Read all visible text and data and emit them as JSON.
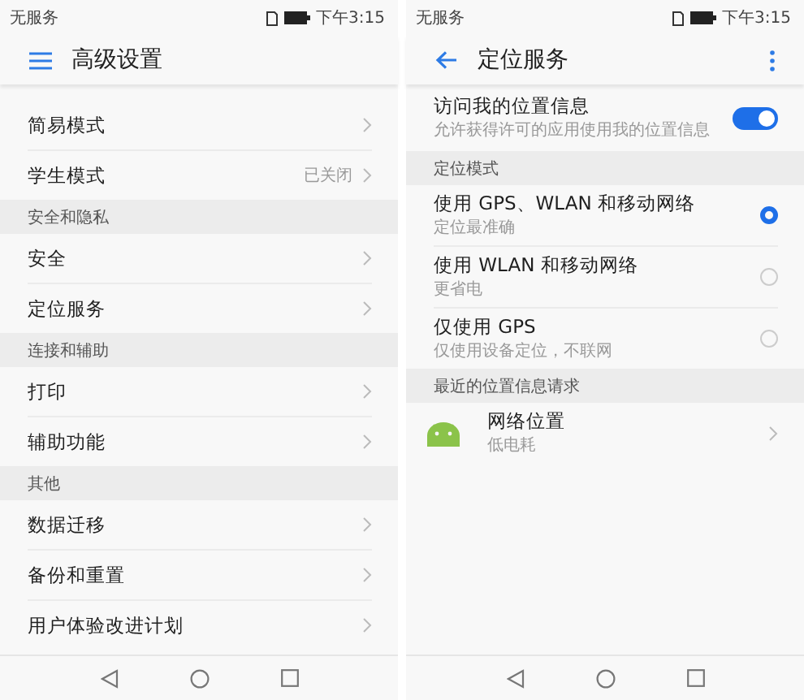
{
  "screens": [
    {
      "status_bar": {
        "carrier": "无服务",
        "time": "下午3:15"
      },
      "header": {
        "leading": {
          "kind": "menu"
        },
        "title": "高级设置",
        "more_menu": false
      },
      "items": [
        {
          "kind": "row",
          "title": "简易模式"
        },
        {
          "kind": "row",
          "title": "学生模式",
          "value": "已关闭"
        },
        {
          "kind": "section",
          "title": "安全和隐私"
        },
        {
          "kind": "row",
          "title": "安全"
        },
        {
          "kind": "row",
          "title": "定位服务"
        },
        {
          "kind": "section",
          "title": "连接和辅助"
        },
        {
          "kind": "row",
          "title": "打印"
        },
        {
          "kind": "row",
          "title": "辅助功能"
        },
        {
          "kind": "section",
          "title": "其他"
        },
        {
          "kind": "row",
          "title": "数据迁移"
        },
        {
          "kind": "row",
          "title": "备份和重置"
        },
        {
          "kind": "row",
          "title": "用户体验改进计划"
        }
      ]
    },
    {
      "status_bar": {
        "carrier": "无服务",
        "time": "下午3:15"
      },
      "header": {
        "leading": {
          "kind": "back"
        },
        "title": "定位服务",
        "more_menu": true
      },
      "items": [
        {
          "kind": "toggle",
          "title": "访问我的位置信息",
          "subtitle": "允许获得许可的应用使用我的位置信息",
          "on": true
        },
        {
          "kind": "section",
          "title": "定位模式"
        },
        {
          "kind": "radio",
          "title": "使用 GPS、WLAN 和移动网络",
          "subtitle": "定位最准确",
          "selected": true
        },
        {
          "kind": "radio",
          "title": "使用 WLAN 和移动网络",
          "subtitle": "更省电",
          "selected": false
        },
        {
          "kind": "radio",
          "title": "仅使用 GPS",
          "subtitle": "仅使用设备定位，不联网",
          "selected": false
        },
        {
          "kind": "section",
          "title": "最近的位置信息请求"
        },
        {
          "kind": "app",
          "title": "网络位置",
          "subtitle": "低电耗"
        }
      ]
    }
  ]
}
